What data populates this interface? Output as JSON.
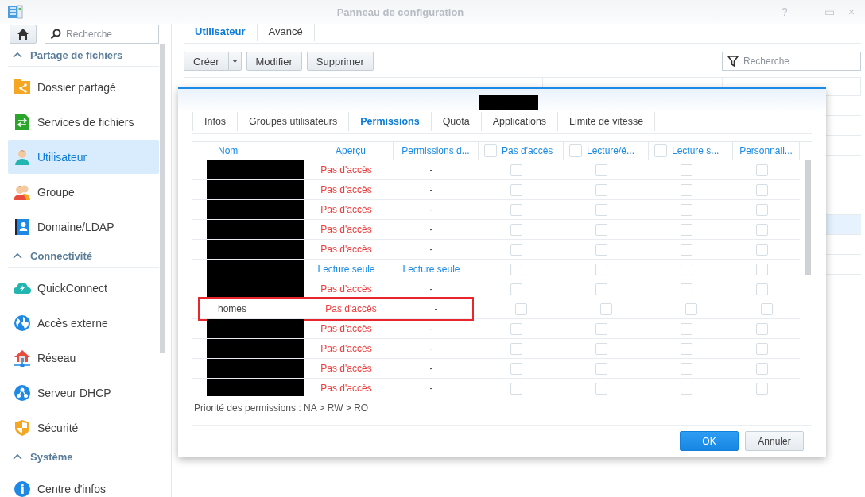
{
  "window": {
    "title": "Panneau de configuration",
    "controls": [
      "?",
      "—",
      "▭",
      "×"
    ]
  },
  "sidebar": {
    "search": {
      "placeholder": "Recherche"
    },
    "sections": [
      {
        "title": "Partage de fichiers",
        "expanded": true,
        "items": [
          {
            "label": "Dossier partagé",
            "selected": false
          },
          {
            "label": "Services de fichiers",
            "selected": false
          },
          {
            "label": "Utilisateur",
            "selected": true
          },
          {
            "label": "Groupe",
            "selected": false
          },
          {
            "label": "Domaine/LDAP",
            "selected": false
          }
        ]
      },
      {
        "title": "Connectivité",
        "expanded": true,
        "items": [
          {
            "label": "QuickConnect",
            "selected": false
          },
          {
            "label": "Accès externe",
            "selected": false
          },
          {
            "label": "Réseau",
            "selected": false
          },
          {
            "label": "Serveur DHCP",
            "selected": false
          },
          {
            "label": "Sécurité",
            "selected": false
          }
        ]
      },
      {
        "title": "Système",
        "expanded": true,
        "items": [
          {
            "label": "Centre d'infos",
            "selected": false
          }
        ]
      }
    ]
  },
  "tabs": [
    {
      "label": "Utilisateur",
      "selected": true
    },
    {
      "label": "Avancé",
      "selected": false
    }
  ],
  "toolbar": {
    "buttons": [
      "Créer",
      "Modifier",
      "Supprimer"
    ],
    "filter": {
      "placeholder": "Recherche"
    }
  },
  "table": {
    "rows": [
      {
        "selected": false
      },
      {
        "selected": false
      },
      {
        "selected": false
      },
      {
        "selected": false
      },
      {
        "selected": false
      },
      {
        "selected": false
      },
      {
        "selected": true
      },
      {
        "selected": false
      },
      {
        "selected": false
      }
    ]
  },
  "dialog": {
    "title_redacted": true,
    "tabs": [
      {
        "label": "Infos",
        "selected": false
      },
      {
        "label": "Groupes utilisateurs",
        "selected": false
      },
      {
        "label": "Permissions",
        "selected": true
      },
      {
        "label": "Quota",
        "selected": false
      },
      {
        "label": "Applications",
        "selected": false
      },
      {
        "label": "Limite de vitesse",
        "selected": false
      }
    ],
    "columns": [
      {
        "label": "Nom",
        "kind": "text"
      },
      {
        "label": "Aperçu",
        "kind": "text"
      },
      {
        "label": "Permissions d...",
        "kind": "text"
      },
      {
        "label": "Pas d'accès",
        "kind": "check",
        "checked": false
      },
      {
        "label": "Lecture/é...",
        "kind": "check",
        "checked": false
      },
      {
        "label": "Lecture s...",
        "kind": "check",
        "checked": false
      },
      {
        "label": "Personnali...",
        "kind": "plain"
      }
    ],
    "rows": [
      {
        "redacted": true,
        "kind": "no_access",
        "preview": "Pas d'accès",
        "inherited": "-",
        "checks": [
          false,
          false,
          false,
          false
        ]
      },
      {
        "redacted": true,
        "kind": "no_access",
        "preview": "Pas d'accès",
        "inherited": "-",
        "checks": [
          false,
          false,
          false,
          false
        ]
      },
      {
        "redacted": true,
        "kind": "no_access",
        "preview": "Pas d'accès",
        "inherited": "-",
        "checks": [
          false,
          false,
          false,
          false
        ]
      },
      {
        "redacted": true,
        "kind": "no_access",
        "preview": "Pas d'accès",
        "inherited": "-",
        "checks": [
          false,
          false,
          false,
          false
        ]
      },
      {
        "redacted": true,
        "kind": "no_access",
        "preview": "Pas d'accès",
        "inherited": "-",
        "checks": [
          false,
          false,
          false,
          false
        ]
      },
      {
        "redacted": true,
        "kind": "read_only",
        "preview": "Lecture seule",
        "inherited": "Lecture seule",
        "checks": [
          false,
          false,
          false,
          false
        ]
      },
      {
        "redacted": true,
        "kind": "no_access",
        "preview": "Pas d'accès",
        "inherited": "-",
        "checks": [
          false,
          false,
          false,
          false
        ]
      },
      {
        "name": "homes",
        "redacted": false,
        "outlined": true,
        "kind": "no_access",
        "preview": "Pas d'accès",
        "inherited": "-",
        "checks": [
          false,
          false,
          false,
          false
        ]
      },
      {
        "redacted": true,
        "kind": "no_access",
        "preview": "Pas d'accès",
        "inherited": "-",
        "checks": [
          false,
          false,
          false,
          false
        ]
      },
      {
        "redacted": true,
        "kind": "no_access",
        "preview": "Pas d'accès",
        "inherited": "-",
        "checks": [
          false,
          false,
          false,
          false
        ]
      },
      {
        "redacted": true,
        "kind": "no_access",
        "preview": "Pas d'accès",
        "inherited": "-",
        "checks": [
          false,
          false,
          false,
          false
        ]
      },
      {
        "redacted": true,
        "kind": "no_access",
        "preview": "Pas d'accès",
        "inherited": "-",
        "checks": [
          false,
          false,
          false,
          false
        ]
      }
    ],
    "note": "Priorité des permissions : NA > RW > RO",
    "buttons": [
      {
        "label": "OK",
        "kind": "primary"
      },
      {
        "label": "Annuler",
        "kind": "secondary"
      }
    ]
  }
}
